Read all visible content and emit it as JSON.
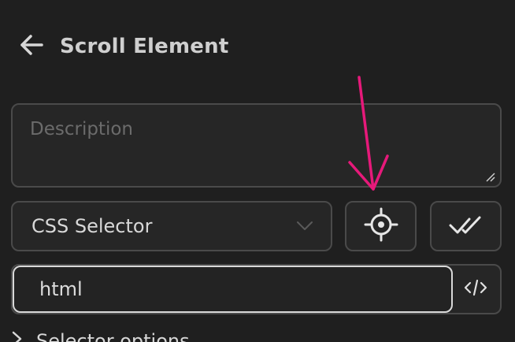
{
  "header": {
    "title": "Scroll Element",
    "back_icon": "arrow-left-icon"
  },
  "form": {
    "description": {
      "placeholder": "Description",
      "value": ""
    },
    "find_by": {
      "selected": "CSS Selector",
      "icon": "chevron-down-icon"
    },
    "element_picker": {
      "icon": "crosshair-icon"
    },
    "verify_selector": {
      "icon": "double-check-icon"
    },
    "selector": {
      "value": "html",
      "code_icon": "code-icon"
    },
    "advanced": {
      "label": "Selector options",
      "icon": "chevron-right-icon"
    }
  },
  "colors": {
    "background": "#1f1f1f",
    "surface": "#262626",
    "border": "#4a4a4a",
    "text": "#d7d7d7",
    "placeholder": "#6b6b6b",
    "focus_border": "#d9d9d9",
    "annotation": "#e6197a"
  }
}
